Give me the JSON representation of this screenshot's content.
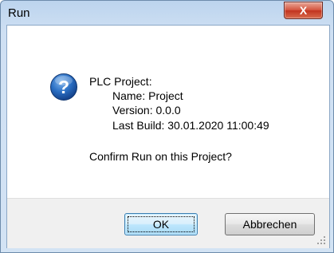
{
  "window": {
    "title": "Run",
    "close_label": "X"
  },
  "icon": {
    "name": "question-icon",
    "glyph": "?"
  },
  "project": {
    "heading": "PLC Project:",
    "name_line": "Name:  Project",
    "version_line": "Version:  0.0.0",
    "last_build_line": "Last Build:  30.01.2020 11:00:49"
  },
  "prompt": "Confirm Run on this Project?",
  "buttons": {
    "ok": "OK",
    "cancel": "Abbrechen"
  },
  "colors": {
    "frame": "#cfe0f3",
    "close": "#c2341f",
    "ok_default": "#a7d9f5",
    "icon_blue": "#1f5fb5"
  }
}
